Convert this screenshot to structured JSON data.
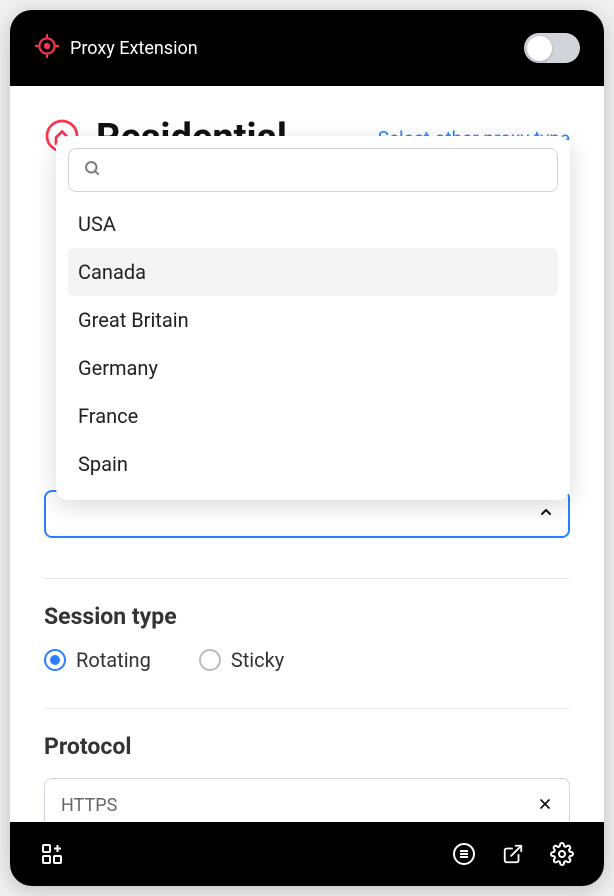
{
  "header": {
    "title": "Proxy Extension",
    "toggle_on": false
  },
  "proxy": {
    "title": "Residential",
    "select_other_label": "Select other proxy type"
  },
  "location_dropdown": {
    "search_placeholder": "",
    "selected": "",
    "options": [
      {
        "label": "USA"
      },
      {
        "label": "Canada",
        "hovered": true
      },
      {
        "label": "Great Britain"
      },
      {
        "label": "Germany"
      },
      {
        "label": "France"
      },
      {
        "label": "Spain"
      }
    ]
  },
  "session_type": {
    "title": "Session type",
    "options": [
      {
        "label": "Rotating",
        "selected": true
      },
      {
        "label": "Sticky",
        "selected": false
      }
    ]
  },
  "protocol": {
    "title": "Protocol",
    "value": "HTTPS"
  },
  "icons": {
    "brand": "target-icon",
    "power": "power-icon",
    "residential": "home-circle-icon",
    "search": "search-icon",
    "chevron_up": "chevron-up-icon",
    "list": "list-icon",
    "external": "external-link-icon",
    "gear": "gear-icon",
    "widgets": "widgets-icon",
    "close": "close-icon"
  },
  "colors": {
    "accent": "#2b7fff",
    "brand": "#f73650",
    "header_bg": "#000000"
  }
}
